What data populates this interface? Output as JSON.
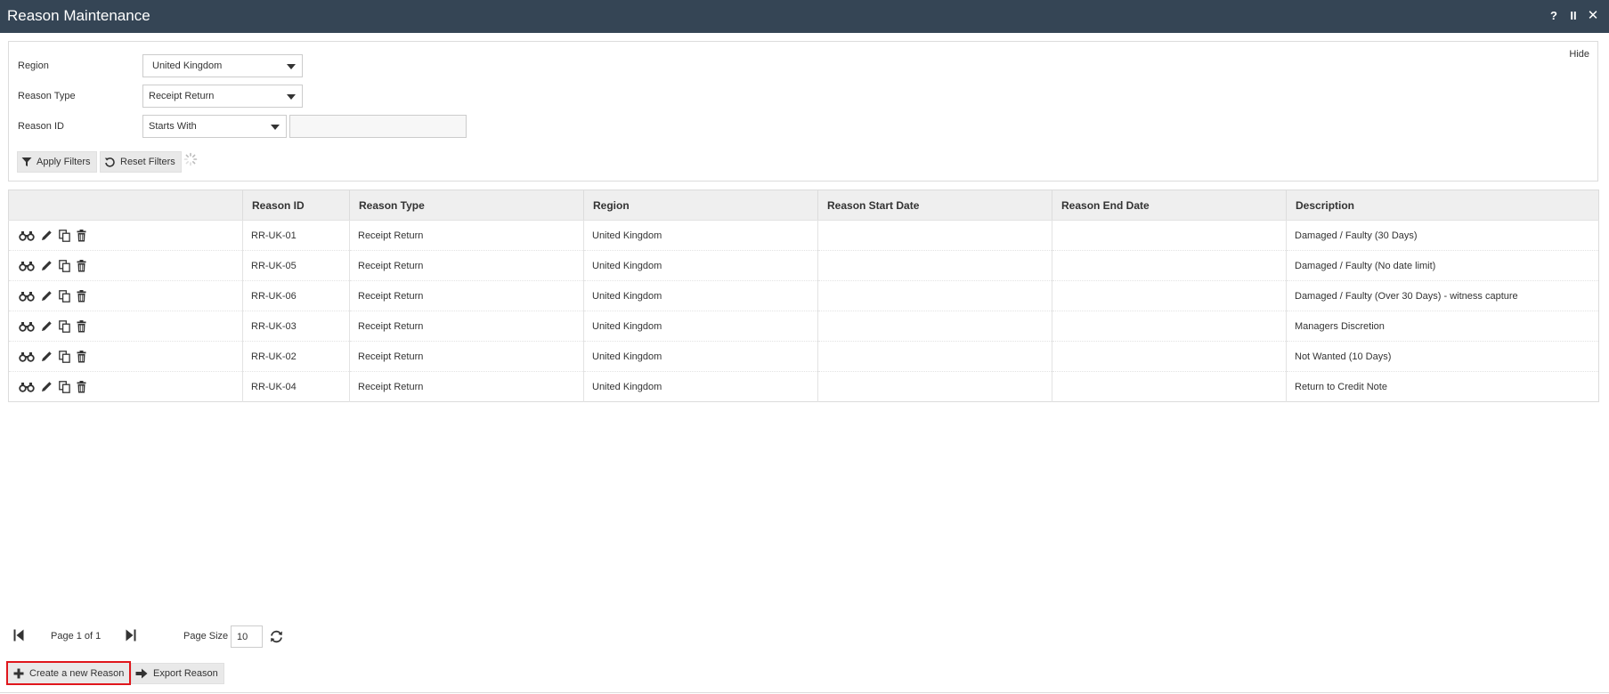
{
  "window": {
    "title": "Reason Maintenance",
    "help_label": "?",
    "pause_label": "II",
    "close_label": "✕"
  },
  "filters": {
    "hide_label": "Hide",
    "region": {
      "label": "Region",
      "value": "United Kingdom"
    },
    "reason_type": {
      "label": "Reason Type",
      "value": "Receipt Return"
    },
    "reason_id": {
      "label": "Reason ID",
      "operator": "Starts With",
      "value": ""
    },
    "apply_label": "Apply Filters",
    "reset_label": "Reset Filters"
  },
  "table": {
    "columns": [
      "",
      "Reason ID",
      "Reason Type",
      "Region",
      "Reason Start Date",
      "Reason End Date",
      "Description"
    ],
    "rows": [
      {
        "id": "RR-UK-01",
        "type": "Receipt Return",
        "region": "United Kingdom",
        "start": "",
        "end": "",
        "description": "Damaged / Faulty (30 Days)"
      },
      {
        "id": "RR-UK-05",
        "type": "Receipt Return",
        "region": "United Kingdom",
        "start": "",
        "end": "",
        "description": "Damaged / Faulty (No date limit)"
      },
      {
        "id": "RR-UK-06",
        "type": "Receipt Return",
        "region": "United Kingdom",
        "start": "",
        "end": "",
        "description": "Damaged / Faulty (Over 30 Days) - witness capture"
      },
      {
        "id": "RR-UK-03",
        "type": "Receipt Return",
        "region": "United Kingdom",
        "start": "",
        "end": "",
        "description": "Managers Discretion"
      },
      {
        "id": "RR-UK-02",
        "type": "Receipt Return",
        "region": "United Kingdom",
        "start": "",
        "end": "",
        "description": "Not Wanted (10 Days)"
      },
      {
        "id": "RR-UK-04",
        "type": "Receipt Return",
        "region": "United Kingdom",
        "start": "",
        "end": "",
        "description": "Return to Credit Note"
      }
    ],
    "row_action_icons": [
      "binoculars-icon",
      "pencil-icon",
      "copy-icon",
      "trash-icon"
    ]
  },
  "pager": {
    "page_text": "Page 1 of 1",
    "page_size_label": "Page Size",
    "page_size_value": "10"
  },
  "footer": {
    "create_label": "Create a new Reason",
    "export_label": "Export Reason"
  },
  "colors": {
    "titlebar": "#354555",
    "header_bg": "#efefef",
    "button_bg": "#e9e9e9",
    "highlight_border": "#e0161c"
  }
}
